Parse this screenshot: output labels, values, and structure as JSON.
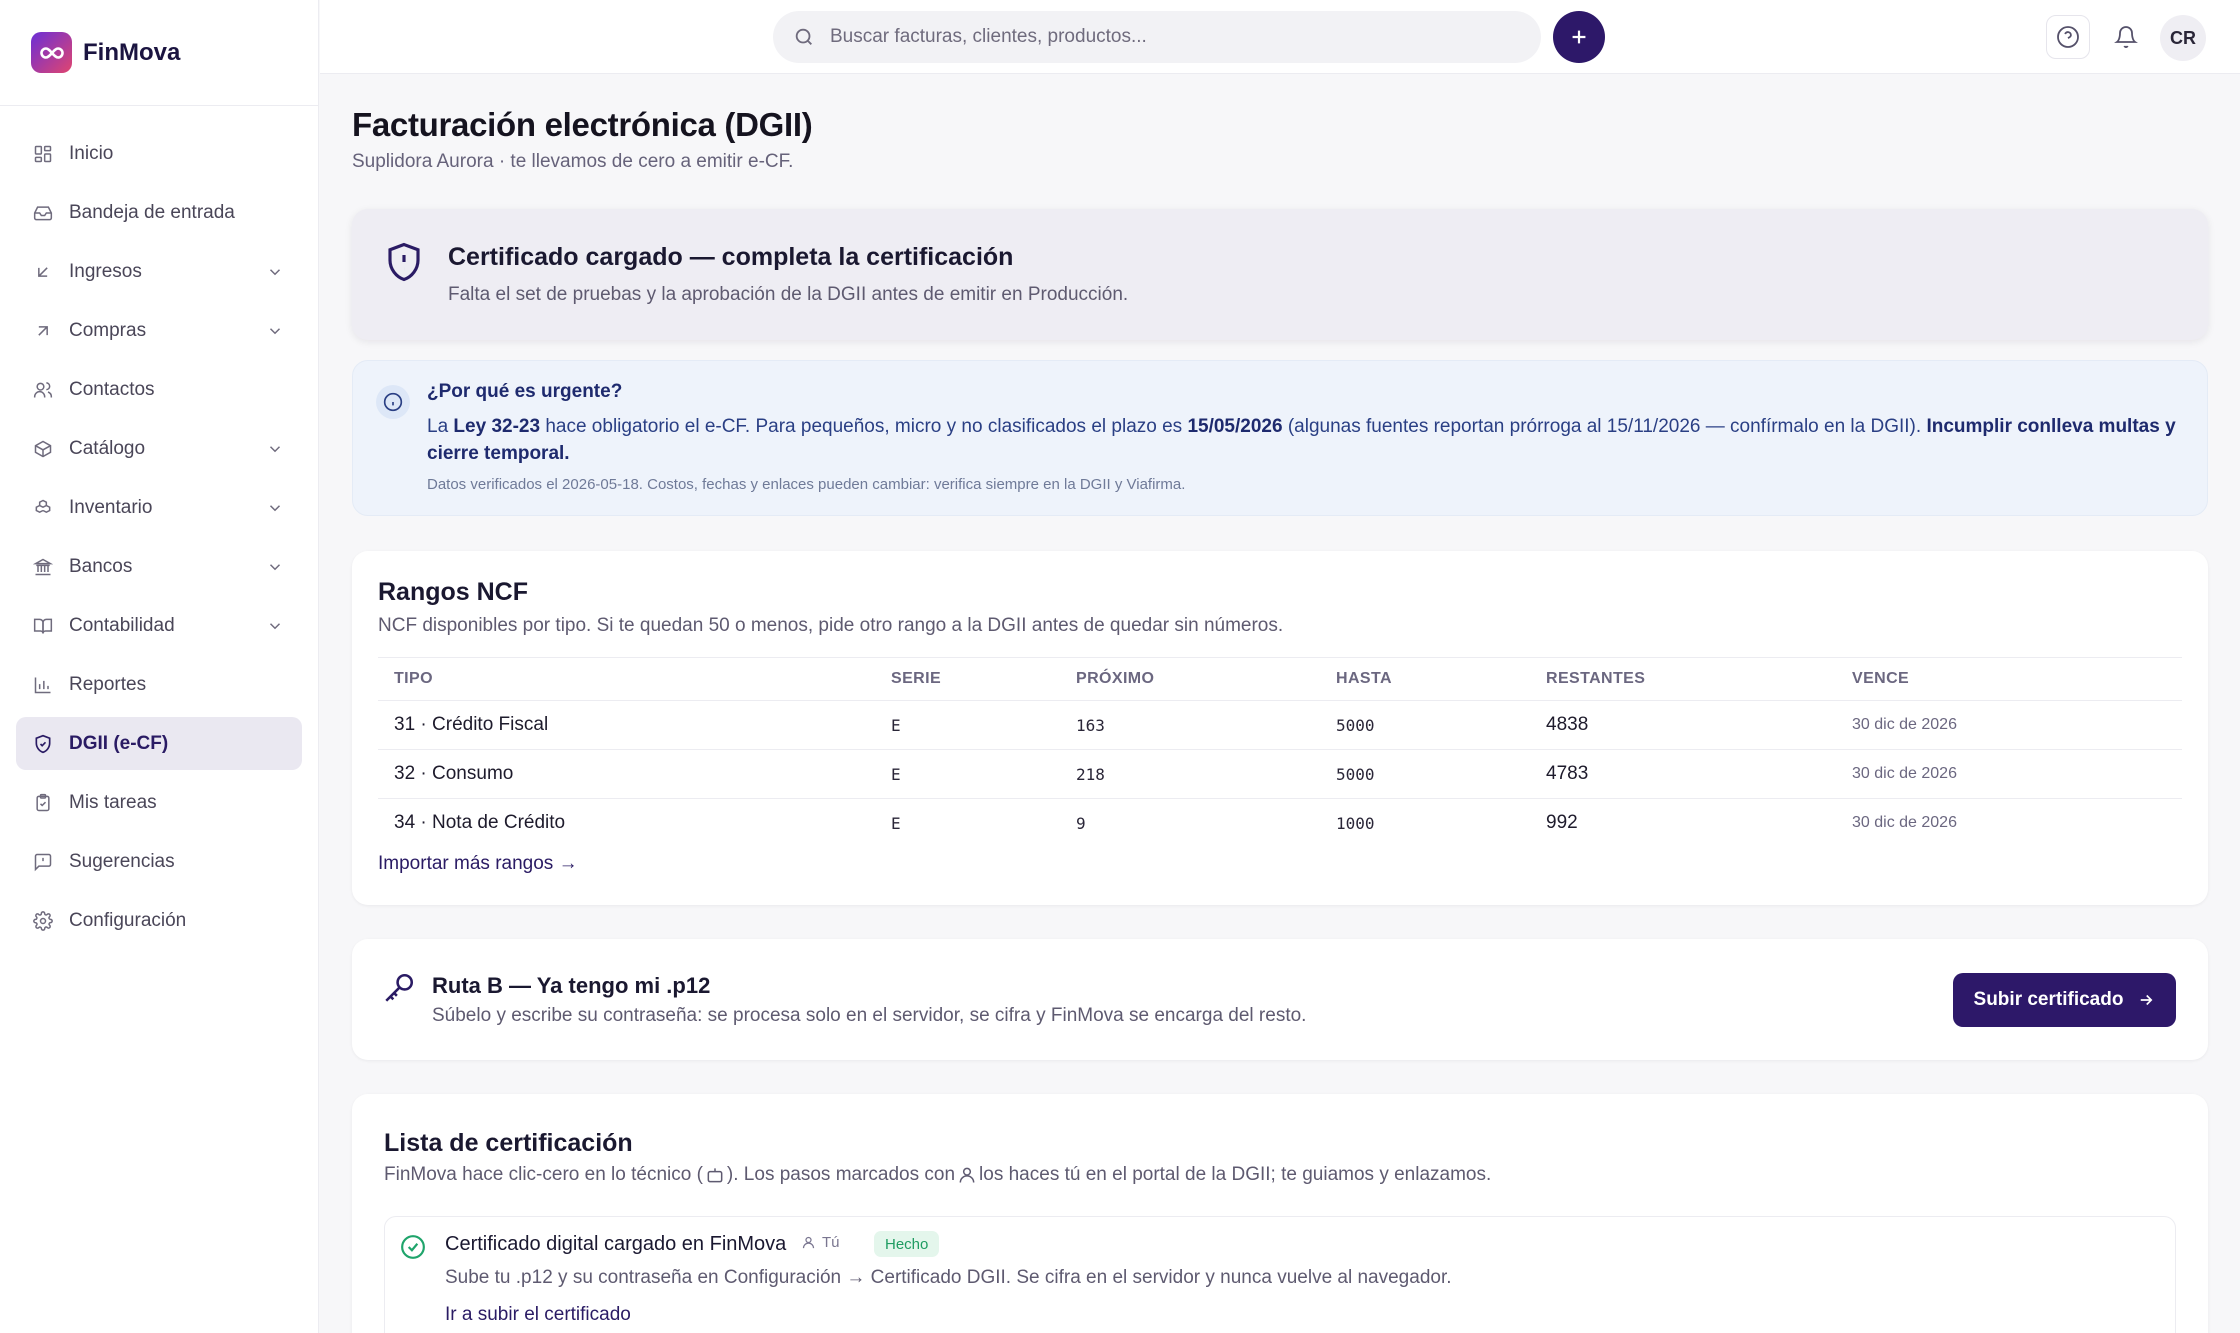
{
  "brand": {
    "name": "FinMova"
  },
  "sidebar": {
    "items": [
      {
        "label": "Inicio",
        "icon": "grid-icon"
      },
      {
        "label": "Bandeja de entrada",
        "icon": "inbox-icon"
      },
      {
        "label": "Ingresos",
        "icon": "arrow-down-left-icon",
        "expandable": true
      },
      {
        "label": "Compras",
        "icon": "arrow-up-right-icon",
        "expandable": true
      },
      {
        "label": "Contactos",
        "icon": "users-icon"
      },
      {
        "label": "Catálogo",
        "icon": "package-icon",
        "expandable": true
      },
      {
        "label": "Inventario",
        "icon": "boxes-icon",
        "expandable": true
      },
      {
        "label": "Bancos",
        "icon": "bank-icon",
        "expandable": true
      },
      {
        "label": "Contabilidad",
        "icon": "book-icon",
        "expandable": true
      },
      {
        "label": "Reportes",
        "icon": "bar-chart-icon"
      },
      {
        "label": "DGII (e-CF)",
        "icon": "shield-check-icon",
        "active": true
      },
      {
        "label": "Mis tareas",
        "icon": "clipboard-icon"
      },
      {
        "label": "Sugerencias",
        "icon": "message-icon"
      },
      {
        "label": "Configuración",
        "icon": "gear-icon"
      }
    ]
  },
  "topbar": {
    "search_placeholder": "Buscar facturas, clientes, productos...",
    "avatar_initials": "CR"
  },
  "page": {
    "title": "Facturación electrónica (DGII)",
    "subtitle": "Suplidora Aurora · te llevamos de cero a emitir e-CF."
  },
  "alert": {
    "title": "Certificado cargado — completa la certificación",
    "text": "Falta el set de pruebas y la aprobación de la DGII antes de emitir en Producción."
  },
  "info": {
    "title": "¿Por qué es urgente?",
    "text_1": "La ",
    "law": "Ley 32-23",
    "text_2": " hace obligatorio el e-CF. Para pequeños, micro y no clasificados el plazo es ",
    "deadline": "15/05/2026",
    "text_3": " (algunas fuentes reportan prórroga al 15/11/2026 — confírmalo en la DGII). ",
    "consequence": "Incumplir conlleva multas y cierre temporal.",
    "note": "Datos verificados el 2026-05-18. Costos, fechas y enlaces pueden cambiar: verifica siempre en la DGII y Viafirma."
  },
  "ncf": {
    "title": "Rangos NCF",
    "subtitle": "NCF disponibles por tipo. Si te quedan 50 o menos, pide otro rango a la DGII antes de quedar sin números.",
    "columns": [
      "TIPO",
      "SERIE",
      "PRÓXIMO",
      "HASTA",
      "RESTANTES",
      "VENCE"
    ],
    "rows": [
      {
        "tipo": "31 · Crédito Fiscal",
        "serie": "E",
        "proximo": "163",
        "hasta": "5000",
        "restantes": "4838",
        "vence": "30 dic de 2026"
      },
      {
        "tipo": "32 · Consumo",
        "serie": "E",
        "proximo": "218",
        "hasta": "5000",
        "restantes": "4783",
        "vence": "30 dic de 2026"
      },
      {
        "tipo": "34 · Nota de Crédito",
        "serie": "E",
        "proximo": "9",
        "hasta": "1000",
        "restantes": "992",
        "vence": "30 dic de 2026"
      }
    ],
    "import_link": "Importar más rangos →"
  },
  "ruta": {
    "title": "Ruta B — Ya tengo mi .p12",
    "text": "Súbelo y escribe su contraseña: se procesa solo en el servidor, se cifra y FinMova se encarga del resto.",
    "button": "Subir certificado"
  },
  "lista": {
    "title": "Lista de certificación",
    "sub_1": "FinMova hace clic-cero en lo técnico (",
    "sub_2": "). Los pasos marcados con ",
    "sub_3": " los haces tú en el portal de la DGII; te guiamos y enlazamos.",
    "steps": [
      {
        "title": "Certificado digital cargado en FinMova",
        "who": "Tú",
        "status": "Hecho",
        "text": "Sube tu .p12 y su contraseña en Configuración → Certificado DGII. Se cifra en el servidor y nunca vuelve al navegador.",
        "link": "Ir a subir el certificado"
      }
    ]
  },
  "colors": {
    "accent": "#2d1869",
    "success": "#1fa46b",
    "info_bg": "#eef3fb"
  }
}
